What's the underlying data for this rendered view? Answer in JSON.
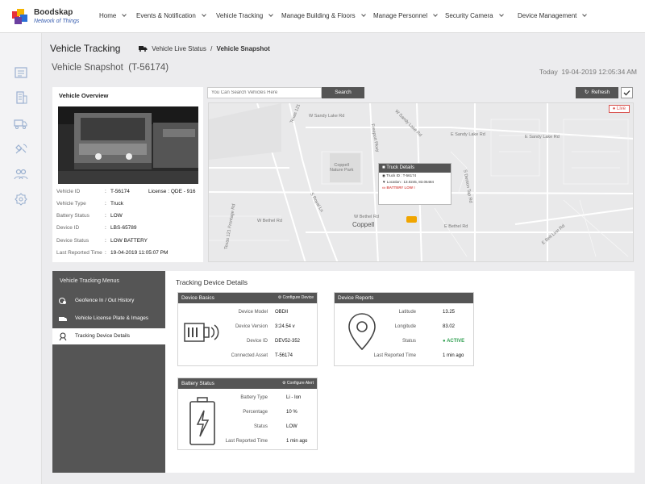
{
  "brand": {
    "name": "Boodskap",
    "tagline": "Network of Things"
  },
  "nav": [
    {
      "label": "Home",
      "has_menu": true
    },
    {
      "label": "Events & Notification",
      "has_menu": true
    },
    {
      "label": "Vehicle Tracking",
      "has_menu": true
    },
    {
      "label": "Manage Building & Floors",
      "has_menu": true
    },
    {
      "label": "Manage Personnel",
      "has_menu": true
    },
    {
      "label": "Security Camera",
      "has_menu": true
    },
    {
      "label": "Device Management",
      "has_menu": true
    }
  ],
  "sidebar_icons": [
    "dashboard-icon",
    "building-icon",
    "truck-icon",
    "satellite-icon",
    "users-icon",
    "settings-icon"
  ],
  "header": {
    "title": "Vehicle Tracking",
    "breadcrumb": {
      "parent": "Vehicle Live Status",
      "separator": "/",
      "current": "Vehicle Snapshot"
    },
    "subtitle": "Vehicle Snapshot  (T-56174)",
    "today": "Today  19-04-2019 12:05:34 AM"
  },
  "overview": {
    "heading": "Vehicle Overview",
    "vehicle_id": {
      "label": "Vehicle ID",
      "value": "T-56174"
    },
    "license": {
      "label": "License : QDE - 916"
    },
    "fields": [
      {
        "label": "Vehicle Type",
        "value": "Truck"
      },
      {
        "label": "Battery Status",
        "value": "LOW"
      },
      {
        "label": "Device ID",
        "value": "LBS-65789"
      },
      {
        "label": "Device Status",
        "value": "LOW BATTERY"
      },
      {
        "label": "Last Reported Time",
        "value": "19-04-2019 11:05:07 PM"
      }
    ]
  },
  "map": {
    "search_placeholder": "You Can Search Vehicles Here",
    "search_label": "Search",
    "refresh_label": "Refresh",
    "live_label": "Live",
    "labels": {
      "sandy1": "W Sandy Lake Rd",
      "sandy2": "W Sandy Lake Rd",
      "sandy3": "E Sandy Lake Rd",
      "sandy4": "E Sandy Lake Rd",
      "park": "Coppell\nNature Park",
      "royal": "S Royal Ln",
      "bethel1": "W Bethel Rd",
      "bethel2": "W Bethel Rd",
      "bethel3": "E Bethel Rd",
      "beltline": "E Belt Line Rd",
      "coppell": "Coppell",
      "freeport": "Freeport Pkwy",
      "texas121": "Texas 121 Frontage Rd",
      "denton": "S Denton Tap Rd",
      "texas121b": "Texas 121"
    },
    "popup": {
      "title": "Truck Details",
      "truck_id": "Truck ID : T-56174",
      "location": "Location : 13.0245, 83.05484",
      "alert": "BATTERY LOW !"
    }
  },
  "menu": {
    "heading": "Vehicle Tracking Menus",
    "items": [
      {
        "label": "Geofence In / Out History",
        "icon": "geofence-icon",
        "active": false
      },
      {
        "label": "Vehicle License Plate & Images",
        "icon": "license-plate-icon",
        "active": false
      },
      {
        "label": "Tracking Device Details",
        "icon": "tracking-device-icon",
        "active": true
      }
    ]
  },
  "tracking": {
    "title": "Tracking Device Details",
    "basics": {
      "title": "Device Basics",
      "action": "Configure Device",
      "fields": [
        {
          "label": "Device Model",
          "value": "OBDII"
        },
        {
          "label": "Device Version",
          "value": "3:24.54 v"
        },
        {
          "label": "Device ID",
          "value": "DEV52-352"
        },
        {
          "label": "Connected Asset",
          "value": "T-56174"
        }
      ]
    },
    "reports": {
      "title": "Device Reports",
      "fields": [
        {
          "label": "Latitude",
          "value": "13.25"
        },
        {
          "label": "Longitude",
          "value": "83.02"
        },
        {
          "label": "Status",
          "value": "ACTIVE"
        },
        {
          "label": "Last Reported Time",
          "value": "1 min ago"
        }
      ]
    },
    "battery": {
      "title": "Battery Status",
      "action": "Configure Alert",
      "fields": [
        {
          "label": "Battery Type",
          "value": "Li - Ion"
        },
        {
          "label": "Percentage",
          "value": "10 %"
        },
        {
          "label": "Status",
          "value": "LOW"
        },
        {
          "label": "Last Reported Time",
          "value": "1 min ago"
        }
      ]
    }
  },
  "colors": {
    "dark_panel": "#555555",
    "alert_red": "#d9534f",
    "active_green": "#2e9e4f",
    "marker": "#f0a500"
  }
}
